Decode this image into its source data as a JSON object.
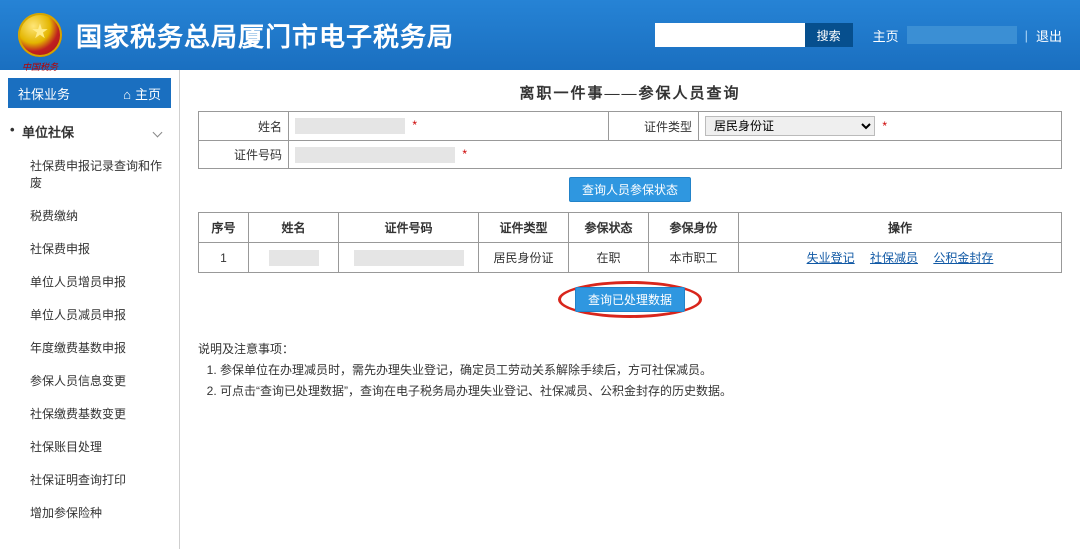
{
  "header": {
    "title": "国家税务总局厦门市电子税务局",
    "search_placeholder": "",
    "search_button": "搜索",
    "home_link": "主页",
    "logout_link": "退出"
  },
  "sidebar": {
    "top_label": "社保业务",
    "top_home": "主页",
    "group_label": "单位社保",
    "items": [
      "社保费申报记录查询和作废",
      "税费缴纳",
      "社保费申报",
      "单位人员增员申报",
      "单位人员减员申报",
      "年度缴费基数申报",
      "参保人员信息变更",
      "社保缴费基数变更",
      "社保账目处理",
      "社保证明查询打印",
      "增加参保险种"
    ]
  },
  "page": {
    "title": "离职一件事——参保人员查询",
    "form": {
      "name_label": "姓名",
      "idtype_label": "证件类型",
      "idtype_value": "居民身份证",
      "idnum_label": "证件号码"
    },
    "query_status_btn": "查询人员参保状态",
    "table": {
      "headers": [
        "序号",
        "姓名",
        "证件号码",
        "证件类型",
        "参保状态",
        "参保身份",
        "操作"
      ],
      "row": {
        "seq": "1",
        "name": "",
        "idnum": "",
        "idtype": "居民身份证",
        "status": "在职",
        "identity": "本市职工",
        "ops": [
          "失业登记",
          "社保减员",
          "公积金封存"
        ]
      }
    },
    "query_processed_btn": "查询已处理数据",
    "notes_title": "说明及注意事项：",
    "notes": [
      "参保单位在办理减员时，需先办理失业登记，确定员工劳动关系解除手续后，方可社保减员。",
      "可点击“查询已处理数据”，查询在电子税务局办理失业登记、社保减员、公积金封存的历史数据。"
    ]
  }
}
